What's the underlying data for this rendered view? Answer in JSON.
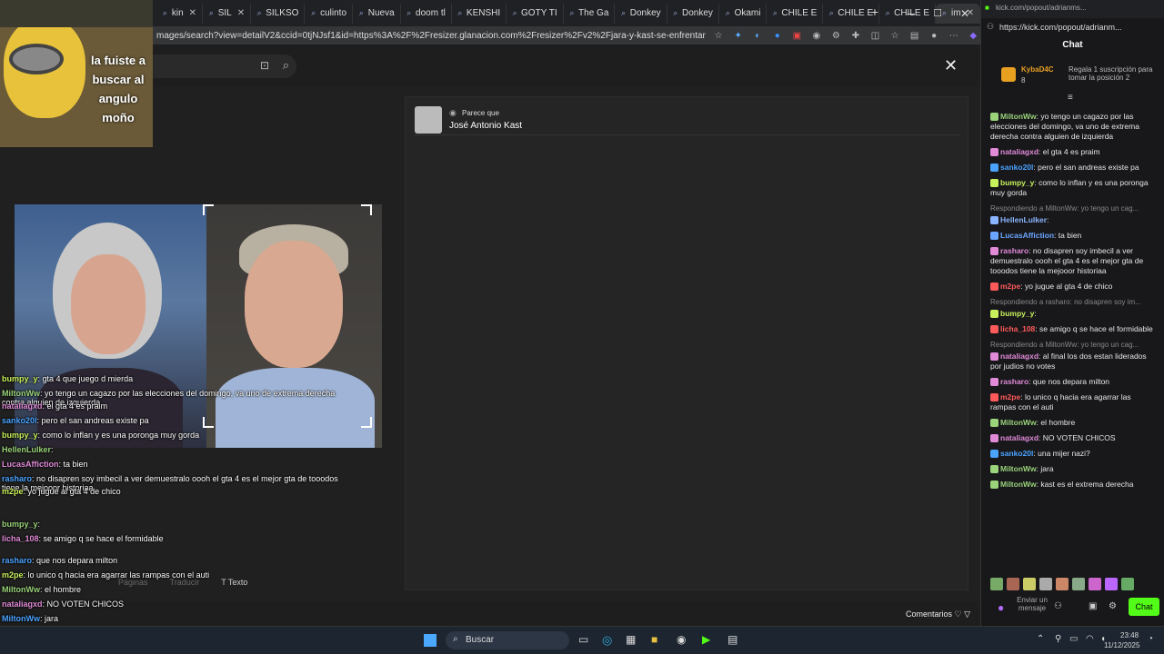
{
  "browser": {
    "tabs": [
      "kin",
      "SIL",
      "SILKSO",
      "culinto",
      "Nueva",
      "doom tl",
      "KENSHI",
      "GOTY TI",
      "The Ga",
      "Donkey",
      "Donkey",
      "Okami",
      "CHILE E",
      "CHILE E",
      "CHILE E",
      "im"
    ],
    "address": "mages/search?view=detailV2&ccid=0tjNJsf1&id=https%3A%2F%2Fresizer.glanacion.com%2Fresizer%2Fv2%2Fjara-y-kast-se-enfrentan-en-las-elecciones-3CBAMB..."
  },
  "overlay_meme": {
    "caption": "la fuiste a buscar al angulo moño"
  },
  "image_panel": {
    "looks_like": "Parece que",
    "person_name": "José Antonio Kast"
  },
  "bottom_toolbar": {
    "pages": "Páginas",
    "translate": "Traducir",
    "text": "Texto"
  },
  "comments_label": "Comentarios",
  "stream_chat_overlay": [
    {
      "user": "bumpy_y",
      "text": "gta 4 que juego d mierda"
    },
    {
      "user": "MiltonWw",
      "text": "yo tengo un cagazo por las elecciones del domingo, va uno de extrema derecha contra alguien de izquierda"
    },
    {
      "user": "nataliagxd",
      "text": "el gta 4 es praim"
    },
    {
      "user": "sanko20l",
      "text": "pero el san andreas existe pa"
    },
    {
      "user": "bumpy_y",
      "text": "como lo inflan y es una poronga muy gorda"
    },
    {
      "user": "HellenLulker",
      "text": ""
    },
    {
      "user": "LucasAffiction",
      "text": "ta bien"
    },
    {
      "user": "rasharo",
      "text": "no disapren soy imbecil a ver demuestralo oooh el gta 4 es el mejor gta de tooodos tiene la mejooor historiaa"
    },
    {
      "user": "m2pe",
      "text": "yo jugue al gta 4 de chico"
    },
    {
      "user": "bumpy_y",
      "text": ""
    },
    {
      "user": "licha_108",
      "text": "se amigo q se hace el formidable"
    },
    {
      "user": "rasharo",
      "text": "que nos depara milton"
    },
    {
      "user": "m2pe",
      "text": "lo unico q hacia era agarrar las rampas con el auti"
    },
    {
      "user": "MiltonWw",
      "text": "el hombre"
    },
    {
      "user": "nataliagxd",
      "text": "NO VOTEN CHICOS"
    },
    {
      "user": "MiltonWw",
      "text": "jara"
    },
    {
      "user": "MiltonWw",
      "text": "kast es el extrema derecha"
    }
  ],
  "kick": {
    "url": "https://kick.com/popout/adrianm...",
    "url_title": "kick.com/popout/adrianms...",
    "chat_title": "Chat",
    "pinned_user": "KybaD4C",
    "pinned_count": "8",
    "gift_text": "Regala 1 suscripción para tomar la posición 2",
    "input_placeholder": "Enviar un mensaje",
    "chat_button": "Chat",
    "messages": [
      {
        "user": "MiltonWw",
        "color": "#9ad37a",
        "text": "yo tengo un cagazo por las elecciones del domingo, va uno de extrema derecha contra alguien de izquierda"
      },
      {
        "user": "nataliagxd",
        "color": "#e08ad8",
        "text": "el gta 4 es praim"
      },
      {
        "user": "sanko20l",
        "color": "#4aa3ff",
        "text": "pero el san andreas existe pa"
      },
      {
        "user": "bumpy_y",
        "color": "#c8f05a",
        "text": "como lo inflan y es una poronga muy gorda"
      },
      {
        "reply": "Respondiendo a MiltonWw: yo tengo un cag..."
      },
      {
        "user": "HellenLulker",
        "color": "#8ab4ff",
        "text": ""
      },
      {
        "user": "LucasAffiction",
        "color": "#6aa6ff",
        "text": "ta bien"
      },
      {
        "user": "rasharo",
        "color": "#e08ad8",
        "text": "no disapren soy imbecil a ver demuestralo oooh el gta 4 es el mejor gta de tooodos tiene la mejooor historiaa"
      },
      {
        "user": "m2pe",
        "color": "#ff5a5a",
        "text": "yo jugue al gta 4 de chico"
      },
      {
        "reply": "Respondiendo a rasharo: no disapren soy im..."
      },
      {
        "user": "bumpy_y",
        "color": "#c8f05a",
        "text": ""
      },
      {
        "user": "licha_108",
        "color": "#ff5a5a",
        "text": "se amigo q se hace el formidable"
      },
      {
        "reply": "Respondiendo a MiltonWw: yo tengo un cag..."
      },
      {
        "user": "nataliagxd",
        "color": "#e08ad8",
        "text": "al final los dos estan liderados por judios no votes"
      },
      {
        "user": "rasharo",
        "color": "#e08ad8",
        "text": "que nos depara milton"
      },
      {
        "user": "m2pe",
        "color": "#ff5a5a",
        "text": "lo unico q hacia era agarrar las rampas con el auti"
      },
      {
        "user": "MiltonWw",
        "color": "#9ad37a",
        "text": "el hombre"
      },
      {
        "user": "nataliagxd",
        "color": "#e08ad8",
        "text": "NO VOTEN CHICOS"
      },
      {
        "user": "sanko20l",
        "color": "#4aa3ff",
        "text": "una mijer nazi?"
      },
      {
        "user": "MiltonWw",
        "color": "#9ad37a",
        "text": "jara"
      },
      {
        "user": "MiltonWw",
        "color": "#9ad37a",
        "text": "kast es el extrema derecha"
      }
    ]
  },
  "taskbar": {
    "search": "Buscar",
    "time": "23:48",
    "date": "11/12/2025"
  }
}
